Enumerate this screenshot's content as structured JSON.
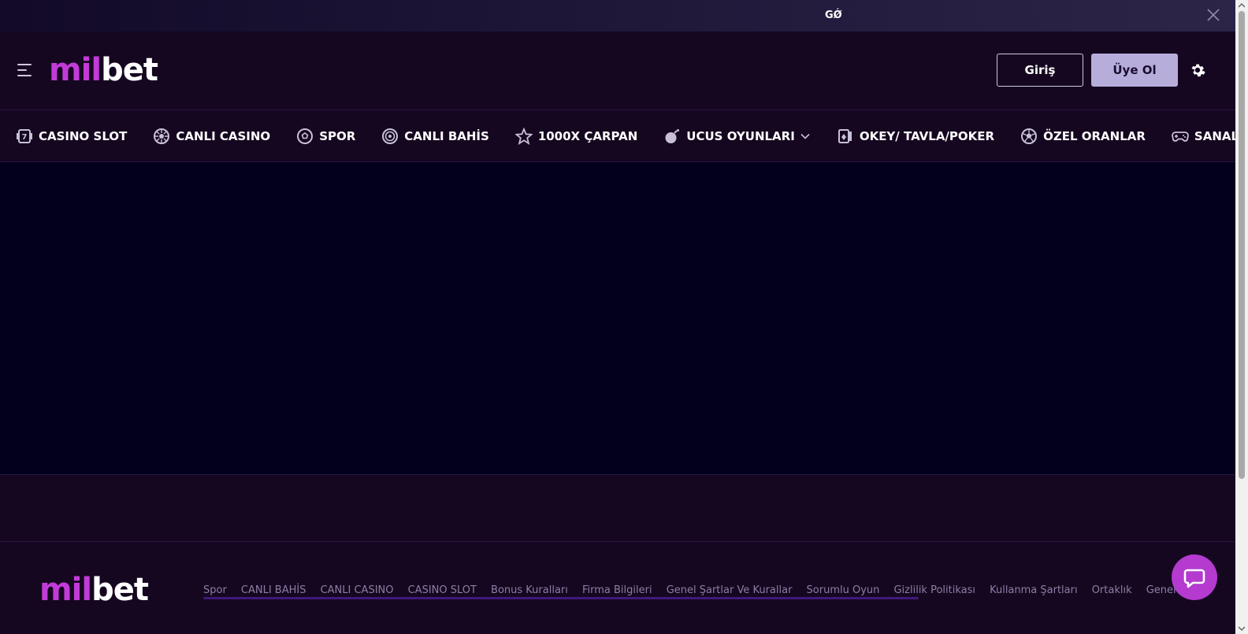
{
  "topbar": {
    "ticker": "GǾ"
  },
  "header": {
    "logo": {
      "part1": "mil",
      "part2": "bet"
    },
    "login_label": "Giriş",
    "register_label": "Üye Ol"
  },
  "nav": {
    "items": [
      {
        "label": "CASINO SLOT",
        "icon": "slot-icon"
      },
      {
        "label": "CANLI CASINO",
        "icon": "roulette-icon"
      },
      {
        "label": "SPOR",
        "icon": "football-icon"
      },
      {
        "label": "CANLI BAHİS",
        "icon": "live-icon"
      },
      {
        "label": "1000X ÇARPAN",
        "icon": "star-icon"
      },
      {
        "label": "UCUS OYUNLARI",
        "icon": "bomb-icon"
      },
      {
        "label": "OKEY/ TAVLA/POKER",
        "icon": "cards-icon"
      },
      {
        "label": "ÖZEL ORANLAR",
        "icon": "football-icon"
      },
      {
        "label": "SANAL BAHİS",
        "icon": "gamepad-icon"
      }
    ]
  },
  "footer": {
    "logo": {
      "part1": "mil",
      "part2": "bet"
    },
    "links": [
      "Spor",
      "CANLI BAHİS",
      "CANLI CASINO",
      "CASINO SLOT",
      "Bonus Kuralları",
      "Firma Bilgileri",
      "Genel Şartlar Ve Kurallar",
      "Sorumlu Oyun",
      "Gizlilik Politikası",
      "Kullanma Şartları",
      "Ortaklık",
      "Genel Oyun/Bahis"
    ]
  },
  "colors": {
    "accent": "#c23bd8",
    "background": "#150720",
    "main": "#02001a",
    "register_button": "#b7addb"
  }
}
